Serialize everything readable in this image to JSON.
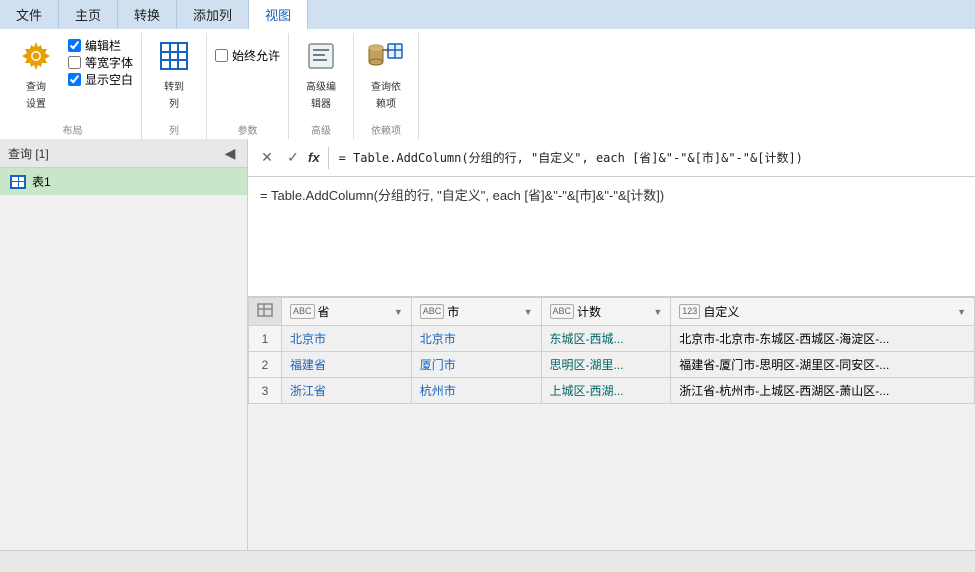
{
  "tabs": [
    {
      "label": "文件",
      "active": false
    },
    {
      "label": "主页",
      "active": false
    },
    {
      "label": "转换",
      "active": false
    },
    {
      "label": "添加列",
      "active": false
    },
    {
      "label": "视图",
      "active": true
    }
  ],
  "ribbon": {
    "groups": [
      {
        "label": "布局",
        "items": [
          {
            "type": "gear",
            "label1": "查询",
            "label2": "设置"
          },
          {
            "type": "checkboxes",
            "options": [
              {
                "checked": true,
                "label": "编辑栏"
              },
              {
                "checked": false,
                "label": "等宽字体"
              },
              {
                "checked": true,
                "label": "显示空白"
              }
            ]
          }
        ]
      },
      {
        "label": "列",
        "items": [
          {
            "type": "grid-btn",
            "label1": "转到",
            "label2": "列"
          }
        ]
      },
      {
        "label": "参数",
        "items": [
          {
            "type": "checkbox-single",
            "label": "始终允许"
          }
        ]
      },
      {
        "label": "高级",
        "items": [
          {
            "type": "btn",
            "icon": "📄",
            "label1": "高级编",
            "label2": "辑器"
          }
        ]
      },
      {
        "label": "依赖项",
        "items": [
          {
            "type": "btn",
            "icon": "🗄",
            "label1": "查询依",
            "label2": "赖项"
          }
        ]
      }
    ]
  },
  "sidebar": {
    "header": "查询 [1]",
    "items": [
      {
        "label": "表1",
        "type": "table"
      }
    ]
  },
  "formula": {
    "value": "= Table.AddColumn(分组的行, \"自定义\", each [省]&\"-\"&[市]&\"-\"&[计数])"
  },
  "table": {
    "columns": [
      {
        "type": "ABC",
        "label": "省"
      },
      {
        "type": "ABC",
        "label": "市"
      },
      {
        "type": "ABC",
        "label": "计数"
      },
      {
        "type": "123",
        "label": "自定义"
      }
    ],
    "rows": [
      {
        "num": "1",
        "cells": [
          "北京市",
          "北京市",
          "东城区-西城...",
          "北京市-北京市-东城区-西城区-海淀区-..."
        ]
      },
      {
        "num": "2",
        "cells": [
          "福建省",
          "厦门市",
          "思明区-湖里...",
          "福建省-厦门市-思明区-湖里区-同安区-..."
        ]
      },
      {
        "num": "3",
        "cells": [
          "浙江省",
          "杭州市",
          "上城区-西湖...",
          "浙江省-杭州市-上城区-西湖区-萧山区-..."
        ]
      }
    ]
  },
  "icons": {
    "close": "✕",
    "check": "✓",
    "fx": "fx",
    "collapse": "◀",
    "expand": "▶",
    "dropdown": "▼",
    "table": "⊞"
  }
}
